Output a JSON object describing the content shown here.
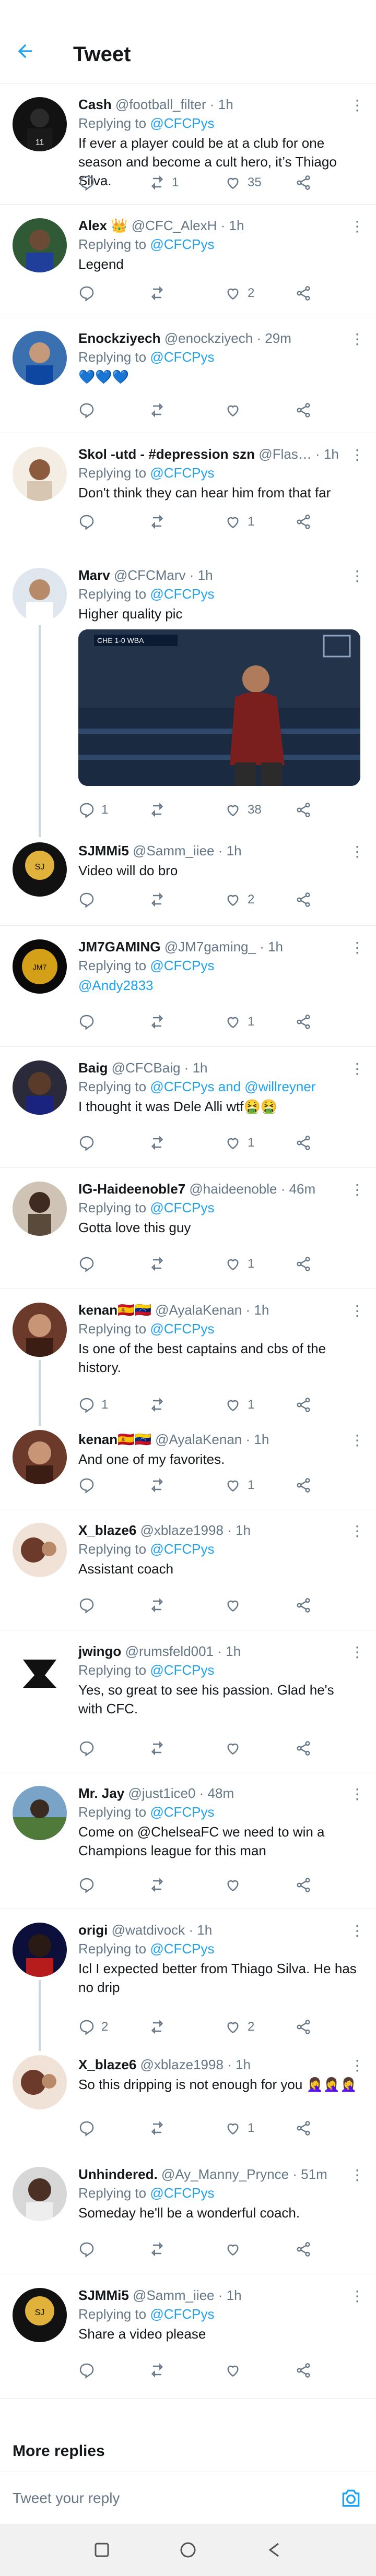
{
  "header": {
    "title": "Tweet",
    "back_icon": "arrow-left-icon"
  },
  "colors": {
    "accent": "#1da1f2",
    "muted": "#657786",
    "divider": "#e6ecf0"
  },
  "tweets": [
    {
      "name": "Cash",
      "handle": "@football_filter",
      "time": "1h",
      "replying_to": "@CFCPys",
      "text": "If ever a player could be at a club for one season and become a cult hero, it’s Thiago Silva.",
      "replies": "",
      "retweets": "1",
      "likes": "35"
    },
    {
      "name": "Alex 👑",
      "handle": "@CFC_AlexH",
      "time": "1h",
      "replying_to": "@CFCPys",
      "text": "Legend",
      "replies": "",
      "retweets": "",
      "likes": "2"
    },
    {
      "name": "Enockziyech",
      "handle": "@enockziyech",
      "time": "29m",
      "replying_to": "@CFCPys",
      "text": "💙💙💙",
      "replies": "",
      "retweets": "",
      "likes": ""
    },
    {
      "name": "Skol -utd - #depression szn",
      "handle": "@Flas…",
      "time": "1h",
      "replying_to": "@CFCPys",
      "text": "Don't think they can hear him from that far",
      "replies": "",
      "retweets": "",
      "likes": "1"
    },
    {
      "name": "Marv",
      "handle": "@CFCMarv",
      "time": "1h",
      "replying_to": "@CFCPys",
      "text": "Higher quality pic",
      "replies": "1",
      "retweets": "",
      "likes": "38"
    },
    {
      "name": "SJMMi5",
      "handle": "@Samm_iiee",
      "time": "1h",
      "replying_to": "",
      "text": "Video will do bro",
      "replies": "",
      "retweets": "",
      "likes": "2"
    },
    {
      "name": "JM7GAMING",
      "handle": "@JM7gaming_",
      "time": "1h",
      "replying_to": "@CFCPys",
      "text": "@Andy2833",
      "replies": "",
      "retweets": "",
      "likes": "1"
    },
    {
      "name": "Baig",
      "handle": "@CFCBaig",
      "time": "1h",
      "replying_to": "@CFCPys and @willreyner",
      "text": "I thought it was Dele Alli wtf🤮🤮",
      "replies": "",
      "retweets": "",
      "likes": "1"
    },
    {
      "name": "IG-Haideenoble7",
      "handle": "@haideenoble",
      "time": "46m",
      "replying_to": "@CFCPys",
      "text": "Gotta love this guy",
      "replies": "",
      "retweets": "",
      "likes": "1"
    },
    {
      "name": "kenan🇪🇸🇻🇪",
      "handle": "@AyalaKenan",
      "time": "1h",
      "replying_to": "@CFCPys",
      "text": "Is one of the best captains and cbs of the history.",
      "replies": "1",
      "retweets": "",
      "likes": "1"
    },
    {
      "name": "kenan🇪🇸🇻🇪",
      "handle": "@AyalaKenan",
      "time": "1h",
      "replying_to": "",
      "text": "And one of my favorites.",
      "replies": "",
      "retweets": "",
      "likes": "1"
    },
    {
      "name": "X_blaze6",
      "handle": "@xblaze1998",
      "time": "1h",
      "replying_to": "@CFCPys",
      "text": "Assistant coach",
      "replies": "",
      "retweets": "",
      "likes": ""
    },
    {
      "name": "jwingo",
      "handle": "@rumsfeld001",
      "time": "1h",
      "replying_to": "@CFCPys",
      "text": "Yes, so great to see his passion.  Glad he's with CFC.",
      "replies": "",
      "retweets": "",
      "likes": ""
    },
    {
      "name": "Mr. Jay",
      "handle": "@just1ice0",
      "time": "48m",
      "replying_to": "@CFCPys",
      "text": "Come on @ChelseaFC we need to win a Champions league for this man",
      "replies": "",
      "retweets": "",
      "likes": ""
    },
    {
      "name": "origi",
      "handle": "@watdivock",
      "time": "1h",
      "replying_to": "@CFCPys",
      "text": "Icl I expected better from Thiago Silva. He has no drip",
      "replies": "2",
      "retweets": "",
      "likes": "2"
    },
    {
      "name": "X_blaze6",
      "handle": "@xblaze1998",
      "time": "1h",
      "replying_to": "",
      "text": "So this dripping is not enough for you 🤦‍♀️🤦‍♀️🤦‍♀️",
      "replies": "",
      "retweets": "",
      "likes": "1"
    },
    {
      "name": "Unhindered.",
      "handle": "@Ay_Manny_Prynce",
      "time": "51m",
      "replying_to": "@CFCPys",
      "text": "Someday he'll be a wonderful coach.",
      "replies": "",
      "retweets": "",
      "likes": ""
    },
    {
      "name": "SJMMi5",
      "handle": "@Samm_iiee",
      "time": "1h",
      "replying_to": "@CFCPys",
      "text": "Share a video please",
      "replies": "",
      "retweets": "",
      "likes": ""
    }
  ],
  "media": {
    "scoreboard": "CHE 1-0 WBA"
  },
  "footer": {
    "more_replies": "More replies",
    "composer_placeholder": "Tweet your reply",
    "camera_icon": "camera-icon"
  },
  "navbar": {
    "icons": [
      "square-icon",
      "circle-icon",
      "triangle-back-icon"
    ]
  }
}
